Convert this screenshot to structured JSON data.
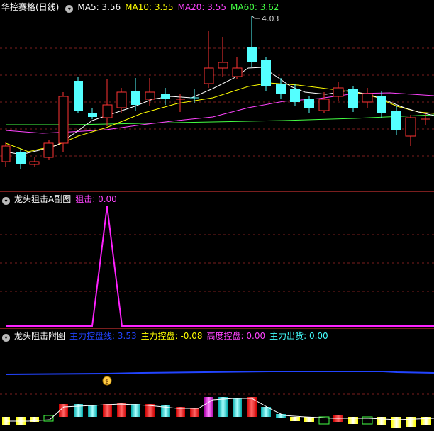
{
  "panel1": {
    "title": "华控赛格(日线)",
    "ma_labels": [
      {
        "label": "MA5: 3.56",
        "color": "#ffffff"
      },
      {
        "label": "MA10: 3.55",
        "color": "#ffff00"
      },
      {
        "label": "MA20: 3.55",
        "color": "#ff44ff"
      },
      {
        "label": "MA60: 3.62",
        "color": "#44ff44"
      }
    ],
    "high_mark": "4.03"
  },
  "panel2": {
    "title": "龙头狙击A副图",
    "indicator": "狙击: 0.00"
  },
  "panel3": {
    "title": "龙头阻击附图",
    "indicators": [
      {
        "label": "主力控盘线: 3.53",
        "color": "#2244ff"
      },
      {
        "label": "主力控盘: -0.08",
        "color": "#ffff00"
      },
      {
        "label": "高度控盘: 0.00",
        "color": "#ff44ff"
      },
      {
        "label": "主力出货: 0.00",
        "color": "#44ffff"
      }
    ],
    "signal_icon": "$"
  },
  "colors": {
    "up": "#ff3333",
    "down": "#54ffff",
    "grid": "#7a1e1e"
  },
  "icons": {
    "collapse": "chevron-down-icon",
    "signal": "money-bag-icon"
  }
}
